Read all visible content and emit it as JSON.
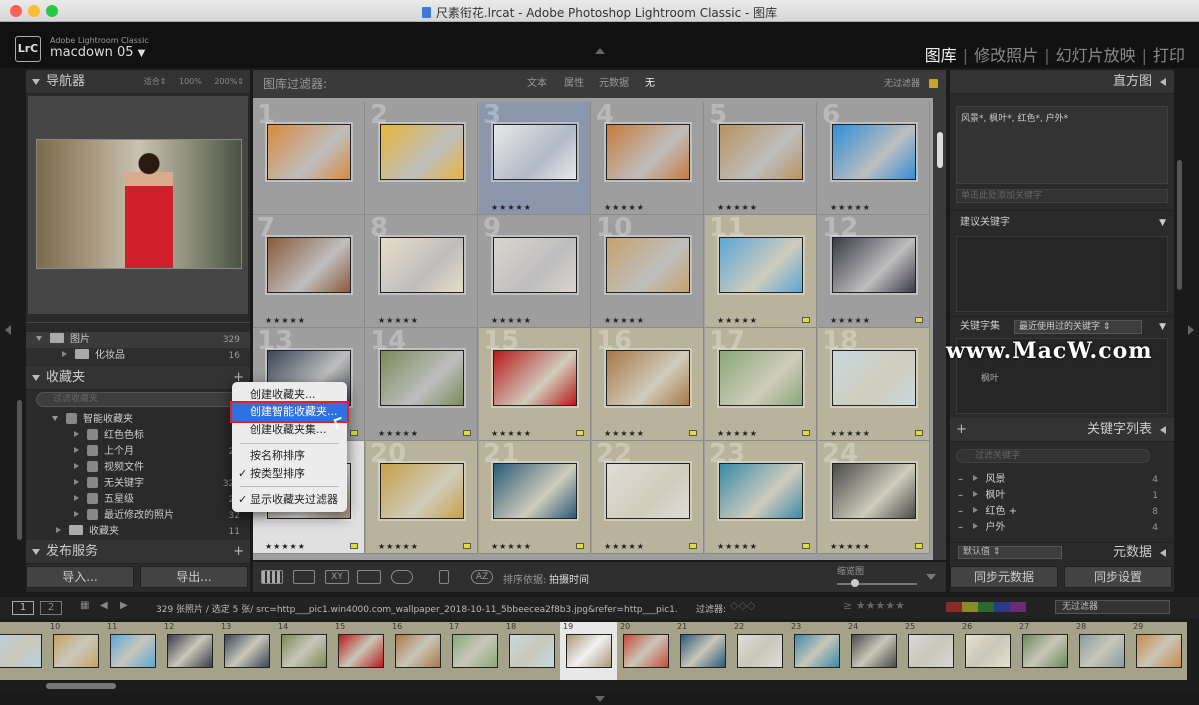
{
  "window": {
    "title": "尺素衔花.lrcat - Adobe Photoshop Lightroom Classic - 图库"
  },
  "identity": {
    "app": "Adobe Lightroom Classic",
    "catalog": "macdown 05",
    "logo": "LrC"
  },
  "modules": [
    "图库",
    "修改照片",
    "幻灯片放映",
    "打印"
  ],
  "left": {
    "navigator": {
      "title": "导航器",
      "zoom_opts": [
        "适合",
        "100%",
        "200%"
      ]
    },
    "folders": [
      {
        "name": "图片",
        "count": "329"
      },
      {
        "name": "化妆品",
        "count": "16"
      }
    ],
    "collections": {
      "title": "收藏夹",
      "search_placeholder": "过滤收藏夹",
      "group": "智能收藏夹",
      "items": [
        {
          "name": "红色色标",
          "count": "0"
        },
        {
          "name": "上个月",
          "count": "22"
        },
        {
          "name": "视频文件",
          "count": "0"
        },
        {
          "name": "无关键字",
          "count": "321"
        },
        {
          "name": "五星级",
          "count": "25"
        },
        {
          "name": "最近修改的照片",
          "count": "32"
        }
      ],
      "tail": {
        "name": "收藏夹",
        "count": "11"
      }
    },
    "publish": {
      "title": "发布服务"
    },
    "import_label": "导入...",
    "export_label": "导出..."
  },
  "filter_bar": {
    "title": "图库过滤器:",
    "opts": [
      "文本",
      "属性",
      "元数据",
      "无"
    ],
    "preset": "无过滤器"
  },
  "grid": {
    "cells": [
      {
        "n": "1",
        "stars": "",
        "c": "#d98a3c"
      },
      {
        "n": "2",
        "stars": "",
        "c": "#e7b63a"
      },
      {
        "n": "3",
        "stars": "★★★★★",
        "c": "#e8e8e8"
      },
      {
        "n": "4",
        "stars": "★★★★★",
        "c": "#c77a3a"
      },
      {
        "n": "5",
        "stars": "★★★★★",
        "c": "#b8935f"
      },
      {
        "n": "6",
        "stars": "★★★★★",
        "c": "#2f8fd6"
      },
      {
        "n": "7",
        "stars": "★★★★★",
        "c": "#8a5a3a"
      },
      {
        "n": "8",
        "stars": "★★★★★",
        "c": "#e8dcc8"
      },
      {
        "n": "9",
        "stars": "★★★★★",
        "c": "#d9d4cf"
      },
      {
        "n": "10",
        "stars": "★★★★★",
        "c": "#c7a26a"
      },
      {
        "n": "11",
        "stars": "★★★★★",
        "c": "#5aa6d8"
      },
      {
        "n": "12",
        "stars": "★★★★★",
        "c": "#3a3a48"
      },
      {
        "n": "13",
        "stars": "",
        "c": "#3a4658"
      },
      {
        "n": "14",
        "stars": "★★★★★",
        "c": "#7a8a5a"
      },
      {
        "n": "15",
        "stars": "★★★★★",
        "c": "#b81a1a"
      },
      {
        "n": "16",
        "stars": "★★★★★",
        "c": "#a87848"
      },
      {
        "n": "17",
        "stars": "★★★★★",
        "c": "#8aa878"
      },
      {
        "n": "18",
        "stars": "★★★★★",
        "c": "#c8d8e0"
      },
      {
        "n": "19",
        "stars": "★★★★★",
        "c": "#a89878"
      },
      {
        "n": "20",
        "stars": "★★★★★",
        "c": "#c8a048"
      },
      {
        "n": "21",
        "stars": "★★★★★",
        "c": "#2a5a7a"
      },
      {
        "n": "22",
        "stars": "★★★★★",
        "c": "#e0dcd8"
      },
      {
        "n": "23",
        "stars": "★★★★★",
        "c": "#3a8aa8"
      },
      {
        "n": "24",
        "stars": "★★★★★",
        "c": "#4a4a4a"
      }
    ]
  },
  "toolbar": {
    "sort_label": "排序依据:",
    "sort_value": "拍摄时间",
    "thumb_label": "缩览图"
  },
  "right": {
    "histogram": {
      "title": "直方图"
    },
    "keyword_tags": "风景*, 枫叶*, 红色*, 户外*",
    "keyword_placeholder": "单击此处添加关键字",
    "suggest": {
      "title": "建议关键字"
    },
    "kwset": {
      "label": "关键字集",
      "value": "最近使用过的关键字",
      "item": "枫叶"
    },
    "kwlist": {
      "title": "关键字列表",
      "search_placeholder": "过滤关键字",
      "items": [
        {
          "name": "风景",
          "count": "4"
        },
        {
          "name": "枫叶",
          "count": "1"
        },
        {
          "name": "红色",
          "count": "8"
        },
        {
          "name": "户外",
          "count": "4"
        }
      ]
    },
    "metadata": {
      "title": "元数据",
      "preset": "默认值"
    },
    "sync_meta": "同步元数据",
    "sync_settings": "同步设置"
  },
  "filmstrip_bar": {
    "page1": "1",
    "page2": "2",
    "info": "329 张照片 / 选定 5 张/ src=http___pic1.win4000.com_wallpaper_2018-10-11_5bbeecea2f8b3.jpg&refer=http___pic1.win4000",
    "filter_label": "过滤器:",
    "filter_value": "无过滤器"
  },
  "filmstrip": [
    {
      "n": "",
      "c": "#b8d0e0"
    },
    {
      "n": "10",
      "c": "#c7a26a"
    },
    {
      "n": "11",
      "c": "#5aa6d8"
    },
    {
      "n": "12",
      "c": "#3a3a48"
    },
    {
      "n": "13",
      "c": "#3a4658"
    },
    {
      "n": "14",
      "c": "#7a8a5a"
    },
    {
      "n": "15",
      "c": "#b81a1a"
    },
    {
      "n": "16",
      "c": "#a87848"
    },
    {
      "n": "17",
      "c": "#8aa878"
    },
    {
      "n": "18",
      "c": "#c8d8e0"
    },
    {
      "n": "19",
      "c": "#a89878"
    },
    {
      "n": "20",
      "c": "#c84a3a"
    },
    {
      "n": "21",
      "c": "#2a5a7a"
    },
    {
      "n": "22",
      "c": "#e0dcd8"
    },
    {
      "n": "23",
      "c": "#3a8aa8"
    },
    {
      "n": "24",
      "c": "#4a4a4a"
    },
    {
      "n": "25",
      "c": "#d8d8d8"
    },
    {
      "n": "26",
      "c": "#e8e0d0"
    },
    {
      "n": "27",
      "c": "#6a8a5a"
    },
    {
      "n": "28",
      "c": "#8a9aa0"
    },
    {
      "n": "29",
      "c": "#c88a4a"
    }
  ],
  "context_menu": {
    "items": [
      {
        "label": "创建收藏夹...",
        "check": ""
      },
      {
        "label": "创建智能收藏夹...",
        "check": ""
      },
      {
        "label": "创建收藏夹集...",
        "check": ""
      },
      {
        "label": "按名称排序",
        "check": ""
      },
      {
        "label": "按类型排序",
        "check": "✓"
      },
      {
        "label": "显示收藏夹过滤器",
        "check": "✓"
      }
    ]
  },
  "watermark": "www.MacW.com"
}
